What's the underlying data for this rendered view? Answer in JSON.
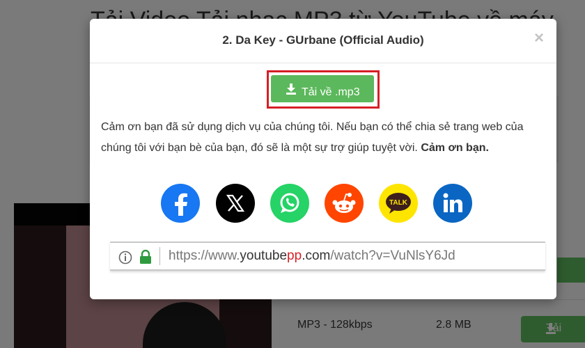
{
  "background": {
    "heading": "Tải Video Tải nhạc MP3 từ YouTube về máy",
    "table_row": {
      "format": "MP3 - 128kbps",
      "size": "2.8 MB",
      "download_label": "Tải"
    }
  },
  "modal": {
    "title": "2. Da Key - GUrbane (Official Audio)",
    "close_symbol": "×",
    "download_button": "Tải về .mp3",
    "thanks_text": "Cảm ơn bạn đã sử dụng dịch vụ của chúng tôi. Nếu bạn có thể chia sẻ trang web của chúng tôi với bạn bè của bạn, đó sẽ là một sự trợ giúp tuyệt vời.",
    "thanks_bold": "Cảm ơn bạn.",
    "share": [
      {
        "name": "facebook-icon",
        "color": "#1877f2"
      },
      {
        "name": "x-icon",
        "color": "#000000"
      },
      {
        "name": "whatsapp-icon",
        "color": "#25d366"
      },
      {
        "name": "reddit-icon",
        "color": "#ff4500"
      },
      {
        "name": "kakaotalk-icon",
        "color": "#fee500",
        "label": "TALK"
      },
      {
        "name": "linkedin-icon",
        "color": "#0a66c2"
      }
    ],
    "url": {
      "prefix": "https://www.",
      "domain_main": "youtube",
      "domain_accent": "pp",
      "domain_tld": ".com",
      "path": "/watch?v=VuNlsY6Jd"
    }
  },
  "colors": {
    "accent_green": "#5cb85c",
    "highlight_red": "#d61f26"
  }
}
